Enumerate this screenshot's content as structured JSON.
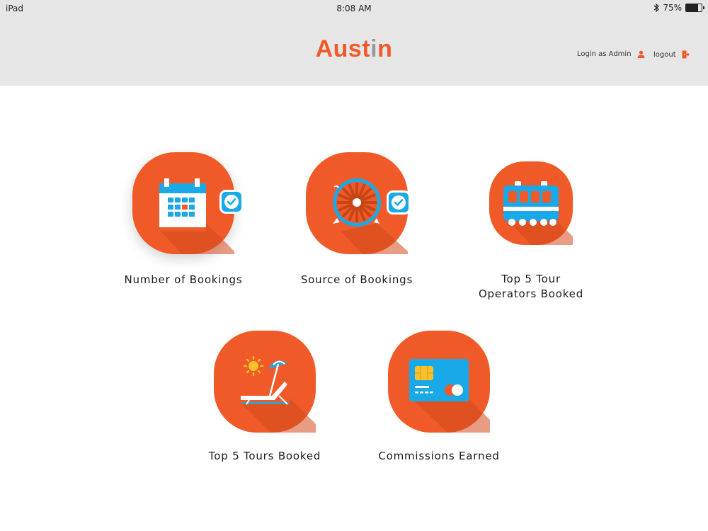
{
  "status_bar": {
    "device": "iPad",
    "time": "8:08 AM",
    "battery_text": "75%",
    "battery_level": 0.75
  },
  "header": {
    "logo_prefix": "Aust",
    "logo_accent": "i",
    "logo_suffix": "n",
    "login_label": "Login as Admin",
    "logout_label": "logout"
  },
  "tiles": [
    {
      "label": "Number of Bookings",
      "icon": "calendar-icon",
      "checked": true
    },
    {
      "label": "Source of Bookings",
      "icon": "wheel-icon",
      "checked": true
    },
    {
      "label": "Top 5 Tour\nOperators Booked",
      "icon": "bus-icon",
      "checked": false
    },
    {
      "label": "Top 5 Tours Booked",
      "icon": "beach-chair-icon",
      "checked": false
    },
    {
      "label": "Commissions Earned",
      "icon": "credit-card-icon",
      "checked": false
    }
  ],
  "colors": {
    "accent": "#f05a28",
    "accent_dark": "#d44a1e",
    "icon_blue": "#1aa9e8",
    "header_bg": "#e6e6e6"
  }
}
